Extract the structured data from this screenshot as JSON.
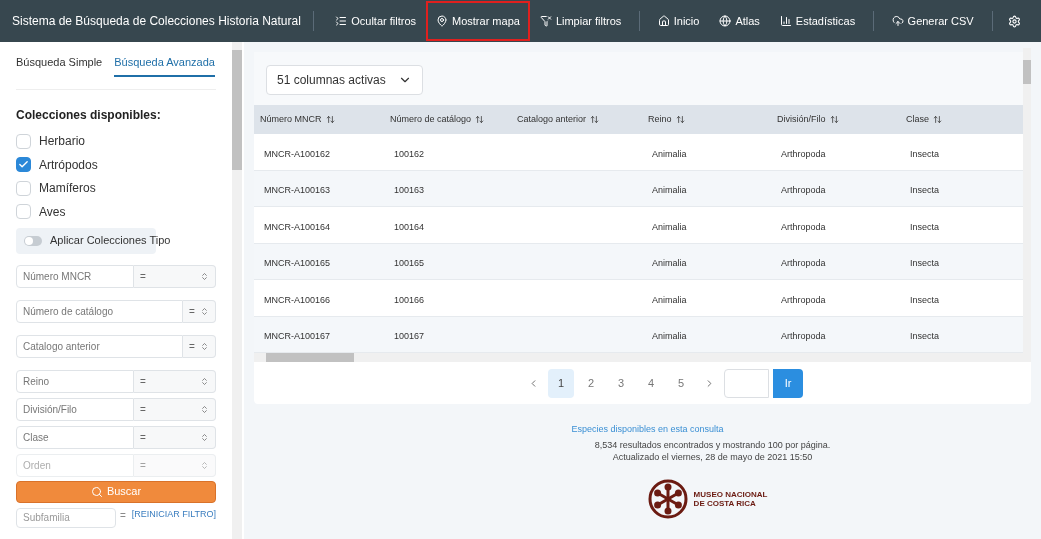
{
  "topbar": {
    "title": "Sistema de Búsqueda de Colecciones Historia Natural",
    "groups": [
      [
        {
          "label": "Ocultar filtros",
          "kind": "filters",
          "highlighted": false
        },
        {
          "label": "Mostrar mapa",
          "kind": "pin",
          "highlighted": true
        },
        {
          "label": "Limpiar filtros",
          "kind": "clear",
          "highlighted": false
        }
      ],
      [
        {
          "label": "Inicio",
          "kind": "home",
          "highlighted": false
        },
        {
          "label": "Atlas",
          "kind": "globe",
          "highlighted": false
        },
        {
          "label": "Estadísticas",
          "kind": "chart",
          "highlighted": false
        }
      ],
      [
        {
          "label": "Generar CSV",
          "kind": "upload",
          "highlighted": false
        }
      ]
    ]
  },
  "sidebar": {
    "tabs": [
      {
        "label": "Búsqueda Simple",
        "selected": false
      },
      {
        "label": "Búsqueda Avanzada",
        "selected": true
      }
    ],
    "heading": "Colecciones disponibles:",
    "collections": [
      {
        "label": "Herbario",
        "checked": false
      },
      {
        "label": "Artrópodos",
        "checked": true
      },
      {
        "label": "Mamíferos",
        "checked": false
      },
      {
        "label": "Aves",
        "checked": false
      }
    ],
    "toggle": {
      "label": "Aplicar Colecciones Tipo",
      "on": false
    },
    "filters": [
      {
        "placeholder": "Número MNCR",
        "operator": "=",
        "kind": "wide",
        "faded": false
      },
      {
        "placeholder": "Número de catálogo",
        "operator": "=",
        "kind": "narrow",
        "faded": false
      },
      {
        "placeholder": "Catalogo anterior",
        "operator": "=",
        "kind": "narrow",
        "faded": false
      },
      {
        "placeholder": "Reino",
        "operator": "=",
        "kind": "wide",
        "faded": false
      },
      {
        "placeholder": "División/Filo",
        "operator": "=",
        "kind": "wide",
        "faded": false
      },
      {
        "placeholder": "Clase",
        "operator": "=",
        "kind": "wide",
        "faded": false
      },
      {
        "placeholder": "Orden",
        "operator": "=",
        "kind": "wide",
        "faded": true
      }
    ],
    "search_button": "Buscar",
    "last_filter": {
      "placeholder": "Subfamilia",
      "operator": "=",
      "faded": true
    },
    "reset_link": "[REINICIAR FILTRO]"
  },
  "columns_select": "51 columnas activas",
  "table": {
    "columns": [
      "Número MNCR",
      "Número de catálogo",
      "Catalogo anterior",
      "Reino",
      "División/Filo",
      "Clase"
    ],
    "rows": [
      [
        "MNCR-A100162",
        "100162",
        "",
        "Animalia",
        "Arthropoda",
        "Insecta"
      ],
      [
        "MNCR-A100163",
        "100163",
        "",
        "Animalia",
        "Arthropoda",
        "Insecta"
      ],
      [
        "MNCR-A100164",
        "100164",
        "",
        "Animalia",
        "Arthropoda",
        "Insecta"
      ],
      [
        "MNCR-A100165",
        "100165",
        "",
        "Animalia",
        "Arthropoda",
        "Insecta"
      ],
      [
        "MNCR-A100166",
        "100166",
        "",
        "Animalia",
        "Arthropoda",
        "Insecta"
      ],
      [
        "MNCR-A100167",
        "100167",
        "",
        "Animalia",
        "Arthropoda",
        "Insecta"
      ]
    ]
  },
  "pagination": {
    "pages": [
      {
        "label": "1",
        "selected": true
      },
      {
        "label": "2",
        "selected": false
      },
      {
        "label": "3",
        "selected": false
      },
      {
        "label": "4",
        "selected": false
      },
      {
        "label": "5",
        "selected": false
      }
    ],
    "go_button": "Ir"
  },
  "footer": {
    "link": "Especies disponibles en esta consulta",
    "results": "8,534 resultados encontrados y mostrando 100 por página.",
    "updated": "Actualizado el viernes, 28 de mayo de 2021 15:50",
    "logo_text": [
      "MUSEO NACIONAL",
      "DE COSTA RICA"
    ]
  }
}
